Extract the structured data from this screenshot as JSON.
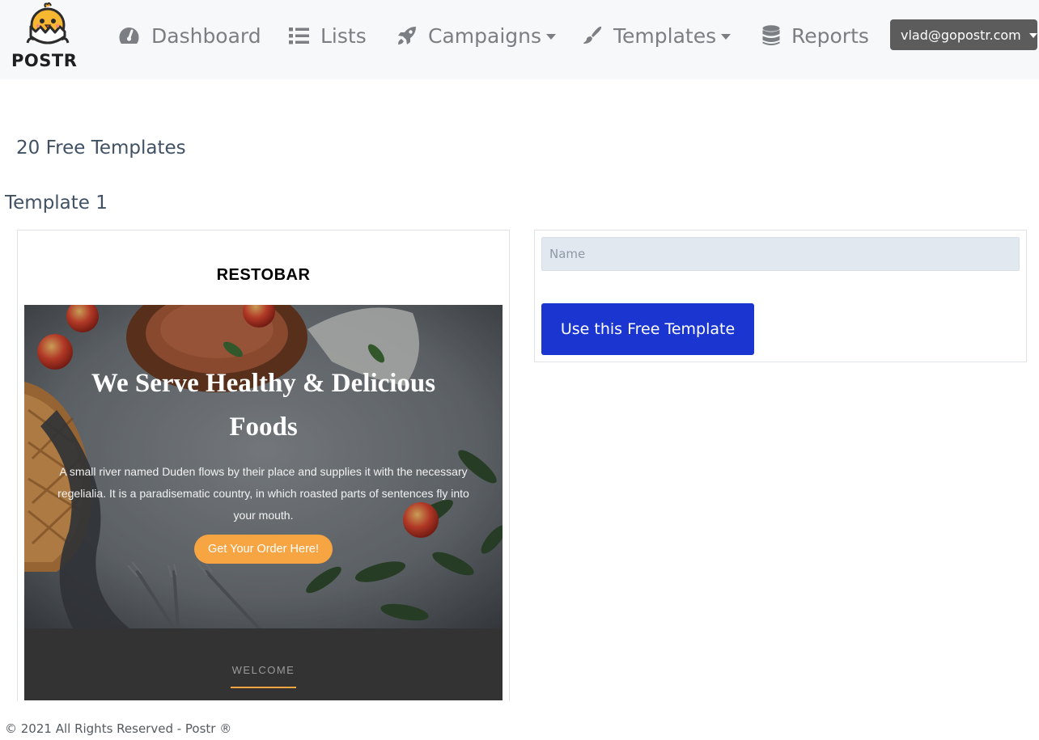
{
  "app": {
    "logo_text": "POSTR"
  },
  "nav": {
    "items": [
      {
        "label": "Dashboard",
        "icon": "gauge-icon"
      },
      {
        "label": "Lists",
        "icon": "list-icon"
      },
      {
        "label": "Campaigns",
        "icon": "rocket-icon",
        "dropdown": true
      },
      {
        "label": "Templates",
        "icon": "paint-brush-icon",
        "dropdown": true
      },
      {
        "label": "Reports",
        "icon": "database-icon"
      }
    ],
    "user_email": "vlad@gopostr.com"
  },
  "page": {
    "count_heading": "20 Free Templates",
    "template_heading": "Template 1"
  },
  "preview": {
    "brand": "RESTOBAR",
    "hero_title": "We Serve Healthy & Delicious Foods",
    "hero_text": "A small river named Duden flows by their place and supplies it with the necessary regelialia. It is a paradisematic country, in which roasted parts of sentences fly into your mouth.",
    "hero_button": "Get Your Order Here!",
    "section_label": "WELCOME"
  },
  "form": {
    "name_placeholder": "Name",
    "name_value": "",
    "submit_label": "Use this Free Template"
  },
  "footer": {
    "text": "© 2021 All Rights Reserved - Postr ®"
  },
  "colors": {
    "navbar_bg": "#f7f8fa",
    "primary_button": "#1a35d0",
    "user_button": "#5c5c5c",
    "accent_orange": "#f7a543",
    "dark_band": "#333333",
    "input_bg": "#e2e8f0"
  }
}
